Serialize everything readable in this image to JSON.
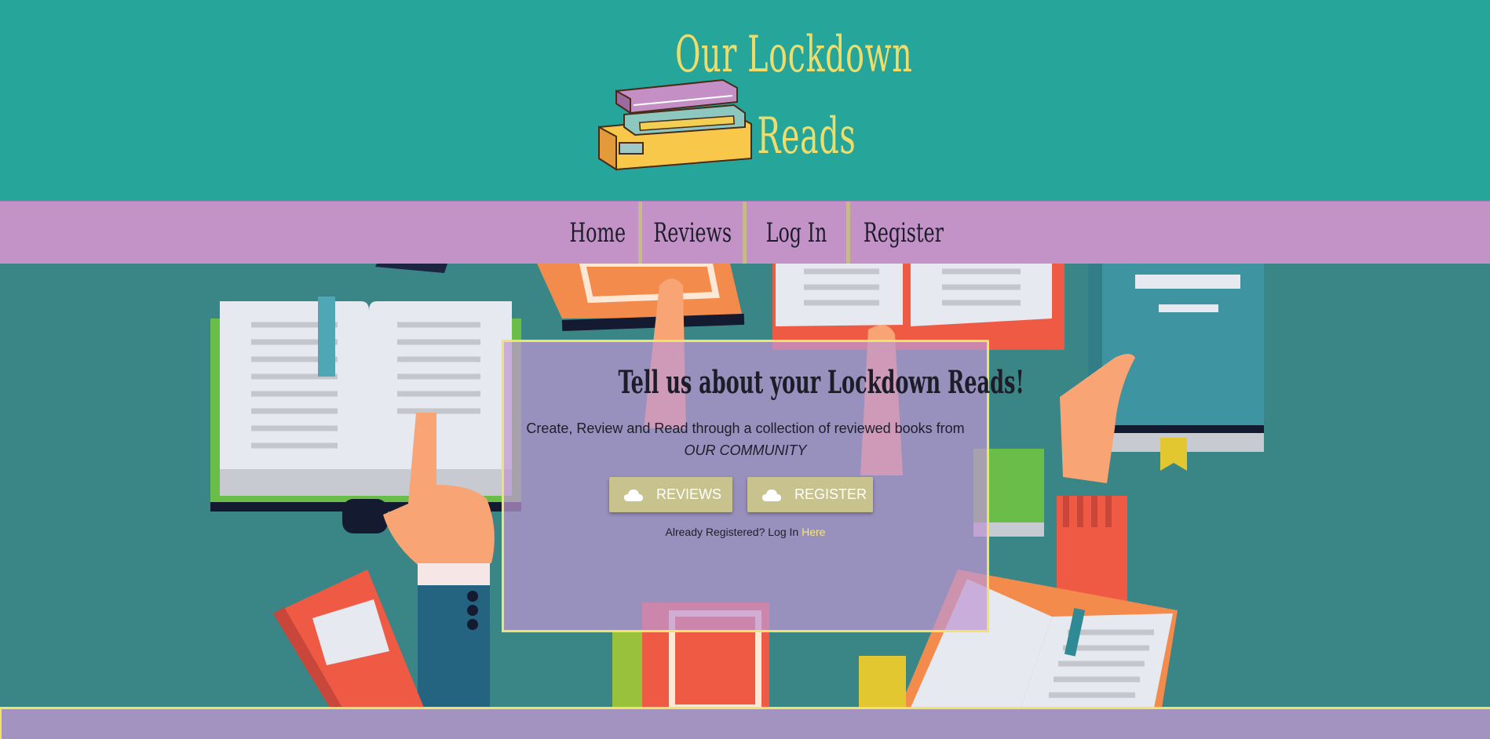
{
  "header": {
    "title_line1": "Our Lockdown",
    "title_line2": "Reads",
    "logo_icon": "book-stack-icon"
  },
  "nav": {
    "items": [
      {
        "label": "Home"
      },
      {
        "label": "Reviews"
      },
      {
        "label": "Log In"
      },
      {
        "label": "Register"
      }
    ]
  },
  "hero": {
    "heading": "Tell us about your Lockdown Reads!",
    "text": "Create, Review and Read through a collection of reviewed books from",
    "text_emphasis": "OUR COMMUNITY",
    "buttons": {
      "reviews_label": "REVIEWS",
      "register_label": "REGISTER",
      "icon": "cloud-icon"
    },
    "login_prompt": "Already Registered? Log In",
    "login_link": "Here"
  },
  "colors": {
    "header_bg": "#26a59a",
    "nav_bg": "#c393c8",
    "hero_bg": "#3a8585",
    "accent_yellow": "#eedd6a",
    "button_bg": "#c8c38e"
  }
}
